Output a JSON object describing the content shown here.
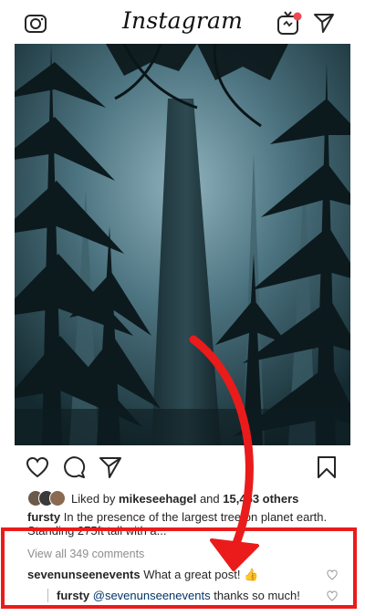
{
  "header": {
    "app_title": "Instagram",
    "icons": [
      "camera-icon",
      "igtv-icon",
      "direct-message-icon"
    ],
    "notification_dot_color": "#ed4956"
  },
  "post": {
    "actions": [
      "heart-icon",
      "comment-icon",
      "share-icon",
      "bookmark-icon"
    ],
    "likes": {
      "prefix": "Liked by",
      "user": "mikeseehagel",
      "and": "and",
      "count": "15,453 others"
    },
    "caption": {
      "user": "fursty",
      "text": "In the presence of the largest tree on planet earth. Standing 275ft tall with a..."
    },
    "view_all": "View all 349 comments",
    "comments": [
      {
        "user": "sevenunseenevents",
        "text": "What a great post! 👍"
      },
      {
        "user": "fursty",
        "mention": "@sevenunseenevents",
        "text": "thanks so much!"
      }
    ]
  },
  "annotation": {
    "color": "#ea1b1b"
  }
}
